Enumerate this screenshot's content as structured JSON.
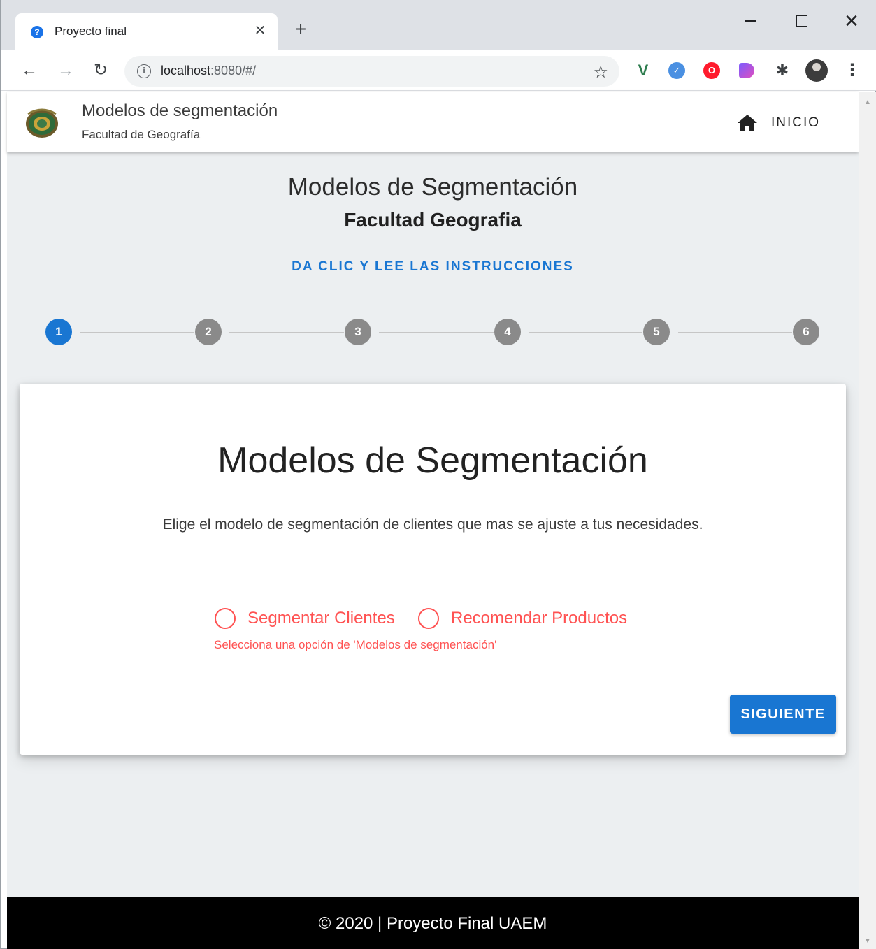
{
  "browser": {
    "tab_title": "Proyecto final",
    "tab_favicon": "?",
    "close_tab_glyph": "✕",
    "new_tab_glyph": "+",
    "url_host": "localhost",
    "url_path": ":8080/#/",
    "info_glyph": "i",
    "extensions": [
      "vue-devtools-icon",
      "blue-extension-icon",
      "opera-adblock-icon",
      "purple-extension-icon",
      "puzzle-extensions-icon",
      "profile-avatar"
    ]
  },
  "appbar": {
    "title": "Modelos de segmentación",
    "subtitle": "Facultad de Geografía",
    "home_label": "INICIO"
  },
  "header": {
    "title": "Modelos de Segmentación",
    "subtitle": "Facultad Geografia",
    "instructions_link": "DA CLIC Y LEE LAS INSTRUCCIONES"
  },
  "stepper": {
    "steps": [
      "1",
      "2",
      "3",
      "4",
      "5",
      "6"
    ],
    "active_step": 1
  },
  "card": {
    "title": "Modelos de Segmentación",
    "description": "Elige el modelo de segmentación de clientes que mas se ajuste a tus necesidades.",
    "options": [
      "Segmentar Clientes",
      "Recomendar Productos"
    ],
    "error": "Selecciona una opción de 'Modelos de segmentación'",
    "next_label": "SIGUIENTE"
  },
  "footer": {
    "text": "© 2020 | Proyecto Final UAEM"
  },
  "colors": {
    "primary": "#1976d2",
    "error": "#ff5252",
    "background": "#eceff1",
    "footer": "#000000"
  }
}
